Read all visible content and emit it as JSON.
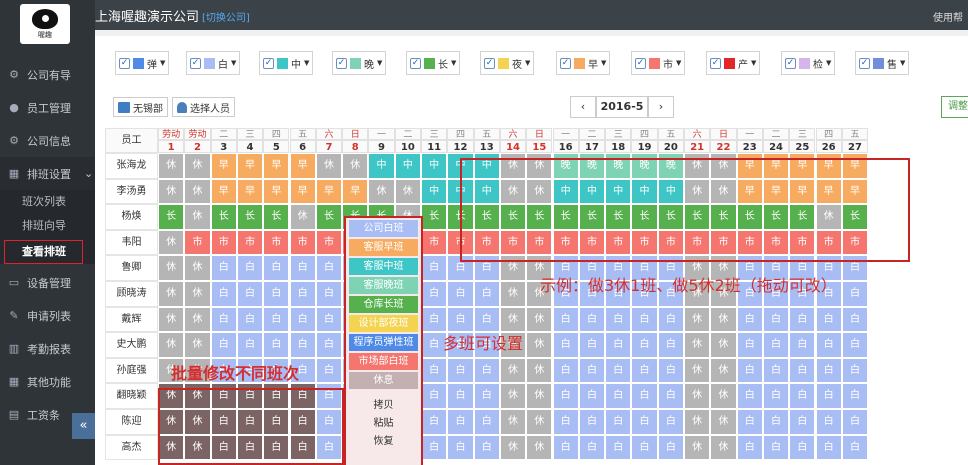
{
  "app": {
    "company": "上海喔趣演示公司",
    "switch_company": "[切换公司]",
    "use_right": "使用帮"
  },
  "logo": {
    "text": "喔趣"
  },
  "sidebar": {
    "items": [
      {
        "label": "公司有导",
        "icon": "gear-icon"
      },
      {
        "label": "员工管理",
        "icon": "user-icon"
      },
      {
        "label": "公司信息",
        "icon": "gear-icon"
      },
      {
        "label": "排班设置",
        "icon": "calendar-icon"
      }
    ],
    "sub_items": [
      "班次列表",
      "排班向导",
      "查看排班"
    ],
    "items_after": [
      {
        "label": "设备管理",
        "icon": "monitor-icon"
      },
      {
        "label": "申请列表",
        "icon": "edit-icon"
      },
      {
        "label": "考勤报表",
        "icon": "chart-icon"
      },
      {
        "label": "其他功能",
        "icon": "grid-icon"
      },
      {
        "label": "工资条",
        "icon": "document-icon"
      }
    ],
    "collapse": "«"
  },
  "filters": [
    {
      "label": "弹",
      "color": "#4f8be6"
    },
    {
      "label": "白",
      "color": "#a9bdf5"
    },
    {
      "label": "中",
      "color": "#3ec6c6"
    },
    {
      "label": "晚",
      "color": "#7fd3b5"
    },
    {
      "label": "长",
      "color": "#56b04e"
    },
    {
      "label": "夜",
      "color": "#f3d34f"
    },
    {
      "label": "早",
      "color": "#f7ab61"
    },
    {
      "label": "市",
      "color": "#f5766f"
    },
    {
      "label": "产",
      "color": "#e3262c"
    },
    {
      "label": "检",
      "color": "#d5b6ea"
    },
    {
      "label": "售",
      "color": "#6f8fd9"
    }
  ],
  "toolbar": {
    "dept": "无锡部",
    "select_people": "选择人员",
    "prev": "‹",
    "month": "2016-5",
    "next": "›",
    "adjust": "调整"
  },
  "table": {
    "employee_header": "员工",
    "week_labels": [
      "日",
      "一",
      "二",
      "三",
      "四",
      "五",
      "六",
      "日",
      "一",
      "二",
      "三",
      "四",
      "五",
      "六",
      "日",
      "一",
      "二",
      "三",
      "四",
      "五",
      "六",
      "日",
      "一",
      "二",
      "三",
      "四",
      "五"
    ],
    "dates": [
      "1",
      "2",
      "3",
      "4",
      "5",
      "6",
      "7",
      "8",
      "9",
      "10",
      "11",
      "12",
      "13",
      "14",
      "15",
      "16",
      "17",
      "18",
      "19",
      "20",
      "21",
      "22",
      "23",
      "24",
      "25",
      "26",
      "27"
    ],
    "holiday_label": "劳动",
    "employees": [
      {
        "name": "张海龙",
        "shifts": [
          "休",
          "休",
          "早",
          "早",
          "早",
          "早",
          "休",
          "休",
          "中",
          "中",
          "中",
          "中",
          "中",
          "休",
          "休",
          "晚",
          "晚",
          "晚",
          "晚",
          "晚",
          "休",
          "休",
          "早",
          "早",
          "早",
          "早",
          "早"
        ]
      },
      {
        "name": "李汤勇",
        "shifts": [
          "休",
          "休",
          "早",
          "早",
          "早",
          "早",
          "早",
          "早",
          "休",
          "休",
          "中",
          "中",
          "中",
          "休",
          "休",
          "中",
          "中",
          "中",
          "中",
          "中",
          "休",
          "休",
          "早",
          "早",
          "早",
          "早",
          "早"
        ]
      },
      {
        "name": "杨焕",
        "shifts": [
          "长",
          "休",
          "长",
          "长",
          "长",
          "休",
          "长",
          "长",
          "长",
          "休",
          "长",
          "长",
          "长",
          "长",
          "长",
          "长",
          "长",
          "长",
          "长",
          "长",
          "长",
          "长",
          "长",
          "长",
          "长",
          "休",
          "长"
        ]
      },
      {
        "name": "韦阳",
        "shifts": [
          "休",
          "市",
          "市",
          "市",
          "市",
          "市",
          "市",
          "市",
          "市",
          "市",
          "市",
          "市",
          "市",
          "市",
          "市",
          "市",
          "市",
          "市",
          "市",
          "市",
          "市",
          "市",
          "市",
          "市",
          "市",
          "市",
          "市"
        ]
      },
      {
        "name": "鲁卿",
        "shifts": [
          "休",
          "休",
          "白",
          "白",
          "白",
          "白",
          "白",
          "白",
          "白",
          "白",
          "白",
          "白",
          "白",
          "休",
          "休",
          "白",
          "白",
          "白",
          "白",
          "白",
          "休",
          "休",
          "白",
          "白",
          "白",
          "白",
          "白"
        ]
      },
      {
        "name": "顾晓涛",
        "shifts": [
          "休",
          "休",
          "白",
          "白",
          "白",
          "白",
          "白",
          "白",
          "白",
          "白",
          "白",
          "白",
          "白",
          "休",
          "休",
          "白",
          "白",
          "白",
          "白",
          "白",
          "休",
          "休",
          "白",
          "白",
          "白",
          "白",
          "白"
        ]
      },
      {
        "name": "戴辉",
        "shifts": [
          "休",
          "休",
          "白",
          "白",
          "白",
          "白",
          "白",
          "白",
          "白",
          "白",
          "白",
          "白",
          "白",
          "休",
          "休",
          "白",
          "白",
          "白",
          "白",
          "白",
          "休",
          "休",
          "白",
          "白",
          "白",
          "白",
          "白"
        ]
      },
      {
        "name": "史大鹏",
        "shifts": [
          "休",
          "休",
          "白",
          "白",
          "白",
          "白",
          "白",
          "白",
          "白",
          "白",
          "白",
          "白",
          "白",
          "休",
          "休",
          "白",
          "白",
          "白",
          "白",
          "白",
          "休",
          "休",
          "白",
          "白",
          "白",
          "白",
          "白"
        ]
      },
      {
        "name": "孙庭强",
        "shifts": [
          "休",
          "休",
          "白",
          "白",
          "白",
          "白",
          "白",
          "白",
          "白",
          "白",
          "白",
          "白",
          "白",
          "休",
          "休",
          "白",
          "白",
          "白",
          "白",
          "白",
          "休",
          "休",
          "白",
          "白",
          "白",
          "白",
          "白"
        ]
      },
      {
        "name": "翻晓颖",
        "shifts": [
          "休",
          "休",
          "白",
          "白",
          "白",
          "白",
          "白",
          "白",
          "白",
          "白",
          "白",
          "白",
          "白",
          "休",
          "休",
          "白",
          "白",
          "白",
          "白",
          "白",
          "休",
          "休",
          "白",
          "白",
          "白",
          "白",
          "白"
        ]
      },
      {
        "name": "陈迎",
        "shifts": [
          "休",
          "休",
          "白",
          "白",
          "白",
          "白",
          "白",
          "白",
          "白",
          "白",
          "白",
          "白",
          "白",
          "休",
          "休",
          "白",
          "白",
          "白",
          "白",
          "白",
          "休",
          "休",
          "白",
          "白",
          "白",
          "白",
          "白"
        ]
      },
      {
        "name": "高杰",
        "shifts": [
          "休",
          "休",
          "白",
          "白",
          "白",
          "白",
          "白",
          "白",
          "白",
          "白",
          "白",
          "白",
          "白",
          "休",
          "休",
          "白",
          "白",
          "白",
          "白",
          "白",
          "休",
          "休",
          "白",
          "白",
          "白",
          "白",
          "白"
        ]
      }
    ]
  },
  "shift_colors": {
    "休": "#b5b5b5",
    "早": "#f7ab61",
    "中": "#3ec6c6",
    "晚": "#7fd3b5",
    "长": "#56b04e",
    "市": "#f5766f",
    "白": "#a9bdf5",
    "dark": "#7c6464"
  },
  "context_menu": {
    "items": [
      {
        "label": "公司白班",
        "color": "#a9bdf5"
      },
      {
        "label": "客服早班",
        "color": "#f7ab61"
      },
      {
        "label": "客服中班",
        "color": "#3ec6c6"
      },
      {
        "label": "客服晚班",
        "color": "#7fd3b5"
      },
      {
        "label": "仓库长班",
        "color": "#56b04e"
      },
      {
        "label": "设计部夜班",
        "color": "#f3d34f"
      },
      {
        "label": "程序员弹性班",
        "color": "#4f8be6"
      },
      {
        "label": "市场部白班",
        "color": "#f5766f"
      },
      {
        "label": "休息",
        "color": "#c4b0b0"
      }
    ],
    "text_items": [
      "拷贝",
      "粘贴",
      "恢复"
    ]
  },
  "annotations": {
    "example": "示例：做3休1班、做5休2班（拖动可改）",
    "multi": "多班可设置",
    "batch": "批量修改不同班次"
  }
}
